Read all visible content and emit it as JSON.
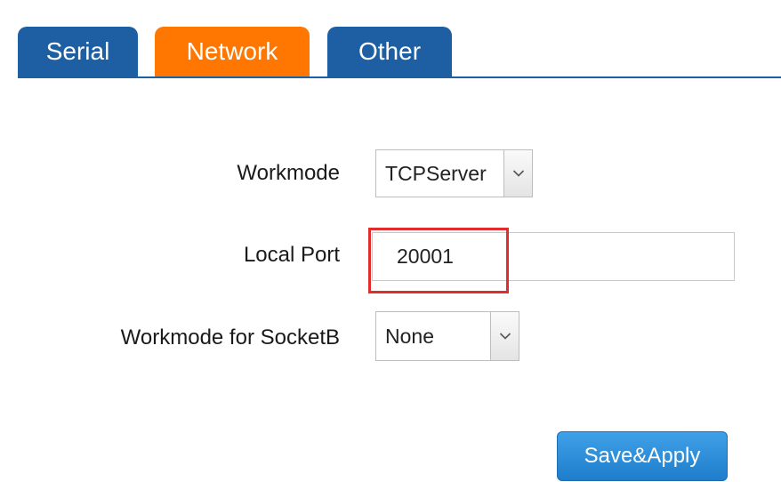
{
  "tabs": {
    "serial": "Serial",
    "network": "Network",
    "other": "Other"
  },
  "form": {
    "workmode_label": "Workmode",
    "workmode_value": "TCPServer",
    "local_port_label": "Local Port",
    "local_port_value": "20001",
    "socketb_label": "Workmode for SocketB",
    "socketb_value": "None"
  },
  "actions": {
    "save_label": "Save&Apply"
  },
  "colors": {
    "tab_blue": "#1e5fa4",
    "tab_active_orange": "#ff7600",
    "highlight_red": "#e32d2d",
    "button_blue": "#2a8fdc"
  },
  "active_tab": "network"
}
